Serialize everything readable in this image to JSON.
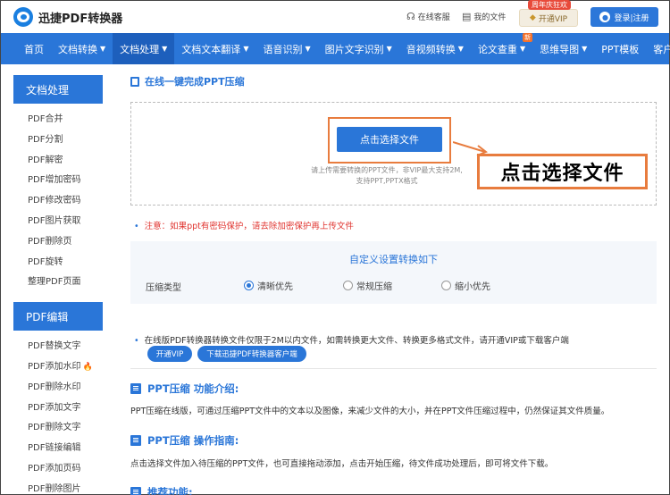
{
  "header": {
    "logo_text": "迅捷PDF转换器",
    "service_label": "在线客服",
    "files_label": "我的文件",
    "vip_promo": "周年庆狂欢",
    "vip_label": "开通VIP",
    "login_label": "登录|注册"
  },
  "nav": {
    "items": [
      {
        "label": "首页",
        "caret": ""
      },
      {
        "label": "文档转换",
        "caret": "▼"
      },
      {
        "label": "文档处理",
        "caret": "▼"
      },
      {
        "label": "文档文本翻译",
        "caret": "▼"
      },
      {
        "label": "语音识别",
        "caret": "▼"
      },
      {
        "label": "图片文字识别",
        "caret": "▼"
      },
      {
        "label": "音视频转换",
        "caret": "▼"
      },
      {
        "label": "论文查重",
        "caret": "▼",
        "badge": "新"
      },
      {
        "label": "思维导图",
        "caret": "▼"
      },
      {
        "label": "PPT模板",
        "caret": ""
      },
      {
        "label": "客户端",
        "caret": "▼"
      }
    ]
  },
  "sidebar": {
    "section1_title": "文档处理",
    "section1_items": [
      "PDF合并",
      "PDF分割",
      "PDF解密",
      "PDF增加密码",
      "PDF修改密码",
      "PDF图片获取",
      "PDF删除页",
      "PDF旋转",
      "整理PDF页面"
    ],
    "section2_title": "PDF编辑",
    "section2_items": [
      "PDF替换文字",
      "PDF添加水印",
      "PDF删除水印",
      "PDF添加文字",
      "PDF删除文字",
      "PDF链接编辑",
      "PDF添加页码",
      "PDF删除图片"
    ]
  },
  "main": {
    "section_title": "在线一键完成PPT压缩",
    "select_button": "点击选择文件",
    "upload_hint_line1": "请上传需要转换的PPT文件，非VIP最大支持2M,",
    "upload_hint_line2": "支持PPT,PPTX格式",
    "callout_text": "点击选择文件",
    "notice": "注意：如果ppt有密码保护，请去除加密保护再上传文件",
    "settings_title": "自定义设置转换如下",
    "compress_type_label": "压缩类型",
    "radio_options": [
      "清晰优先",
      "常规压缩",
      "缩小优先"
    ],
    "radio_selected": "清晰优先",
    "limit_text": "在线版PDF转换器转换文件仅限于2M以内文件，如需转换更大文件、转换更多格式文件，请开通VIP或下载客户端",
    "open_vip_button": "开通VIP",
    "download_button": "下载迅捷PDF转换器客户端",
    "intro_title": "PPT压缩 功能介绍:",
    "intro_text": "PPT压缩在线版，可通过压缩PPT文件中的文本以及图像，来减少文件的大小，并在PPT文件压缩过程中，仍然保证其文件质量。",
    "guide_title": "PPT压缩 操作指南:",
    "guide_text": "点击选择文件加入待压缩的PPT文件，也可直接拖动添加，点击开始压缩，待文件成功处理后，即可将文件下载。",
    "recommend_title": "推荐功能:"
  }
}
